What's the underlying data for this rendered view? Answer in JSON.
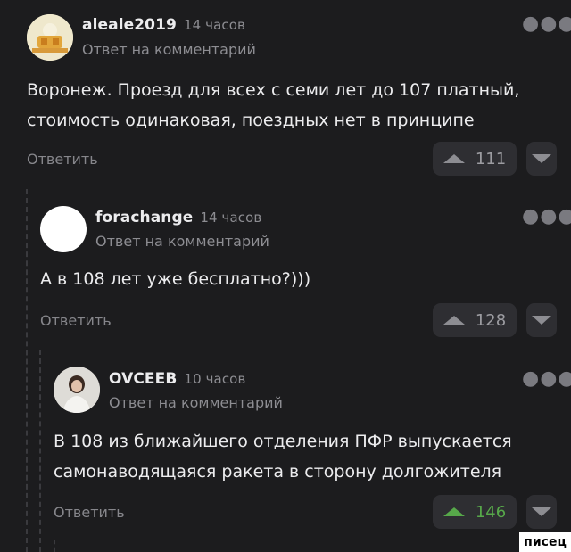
{
  "comments": [
    {
      "username": "aleale2019",
      "time": "14 часов",
      "reply_label": "Ответ на комментарий",
      "text_lines": [
        "Воронеж. Проезд для всех с семи лет до 107 платный,",
        "стоимость одинаковая, поездных нет в принципе"
      ],
      "answer_label": "Ответить",
      "votes": "111",
      "menu_icon": "more-dots-icon"
    },
    {
      "username": "forachange",
      "time": "14 часов",
      "reply_label": "Ответ на комментарий",
      "text_lines": [
        "А в 108 лет уже бесплатно?)))"
      ],
      "answer_label": "Ответить",
      "votes": "128",
      "menu_icon": "more-dots-icon"
    },
    {
      "username": "OVCEEB",
      "time": "10 часов",
      "reply_label": "Ответ на комментарий",
      "text_lines": [
        "В 108 из ближайшего отделения ПФР выпускается",
        "самонаводящаяся ракета в сторону долгожителя"
      ],
      "answer_label": "Ответить",
      "votes": "146",
      "vote_color": "#57a84a",
      "menu_icon": "more-dots-icon"
    }
  ],
  "watermark": "писец"
}
